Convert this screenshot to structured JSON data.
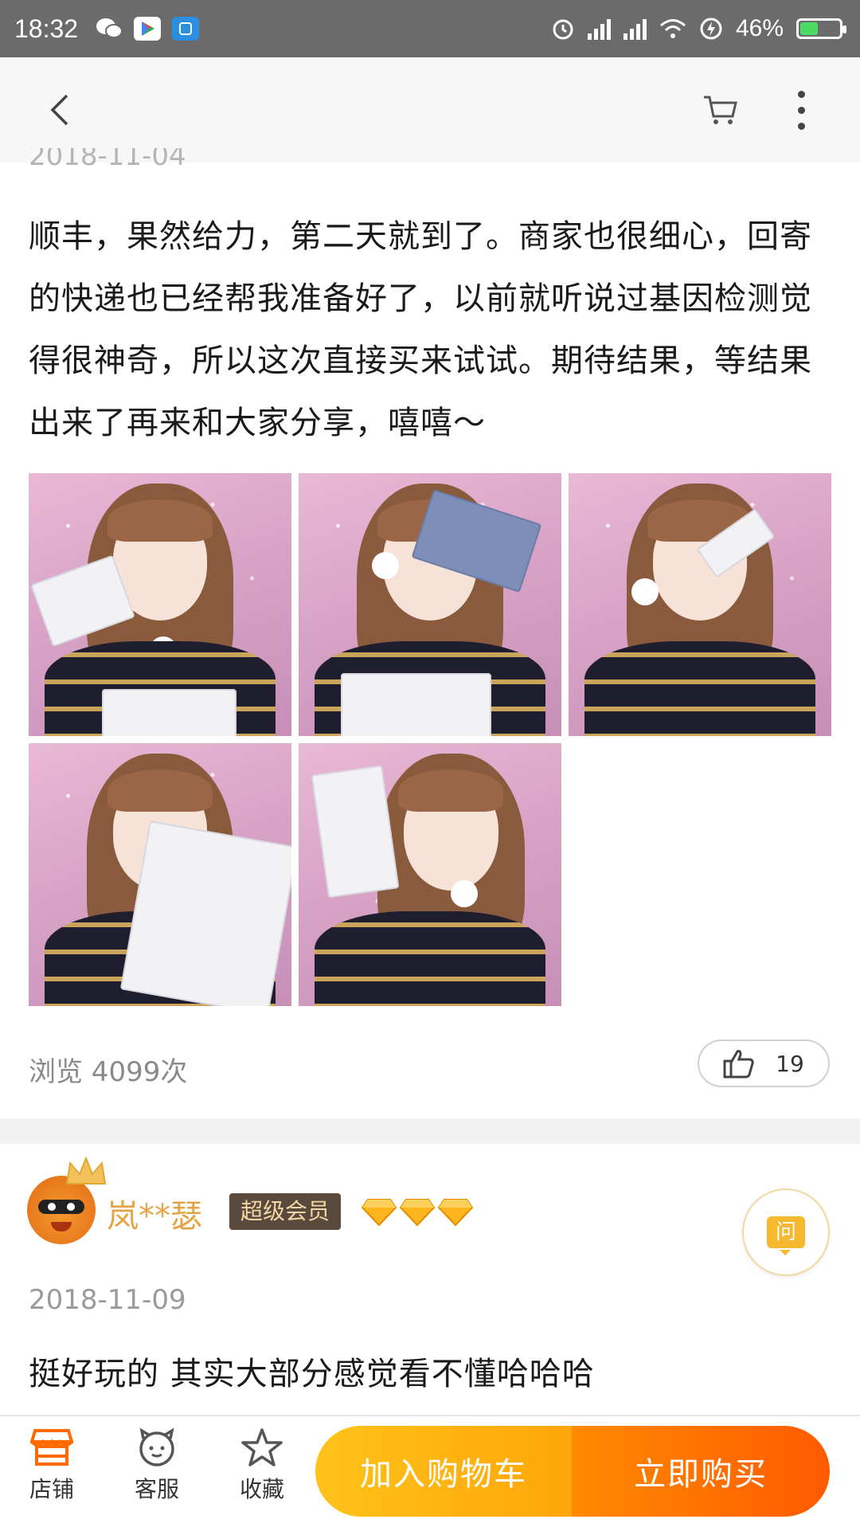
{
  "status_bar": {
    "time": "18:32",
    "battery": "46%",
    "battery_level": 0.46,
    "network": "HD"
  },
  "nav": {
    "back_icon": "chevron-left-icon",
    "cart_icon": "cart-icon",
    "more_icon": "more-vertical-icon"
  },
  "reviews": [
    {
      "date": "2018-11-04",
      "text": "顺丰，果然给力，第二天就到了。商家也很细心，回寄的快递也已经帮我准备好了，以前就听说过基因检测觉得很神奇，所以这次直接买来试试。期待结果，等结果出来了再来和大家分享，嘻嘻～",
      "photo_count": 5,
      "views": "浏览 4099次",
      "likes": "19"
    },
    {
      "username": "岚**瑟",
      "badge": "超级会员",
      "diamond_count": 3,
      "date": "2018-11-09",
      "text": "挺好玩的 其实大部分感觉看不懂哈哈哈"
    }
  ],
  "ask_button": {
    "label": "问"
  },
  "bottom_bar": {
    "tabs": [
      {
        "label": "店铺",
        "icon": "store-icon"
      },
      {
        "label": "客服",
        "icon": "customer-service-icon"
      },
      {
        "label": "收藏",
        "icon": "star-icon"
      }
    ],
    "add_to_cart": "加入购物车",
    "buy_now": "立即购买"
  },
  "colors": {
    "cart_gradient": [
      "#ffc21a",
      "#ffa60a"
    ],
    "buy_gradient": [
      "#ff8a00",
      "#ff5a00"
    ],
    "username": "#e4a446",
    "badge_bg": "#5a4a3e",
    "store_icon": "#ff6a00"
  }
}
